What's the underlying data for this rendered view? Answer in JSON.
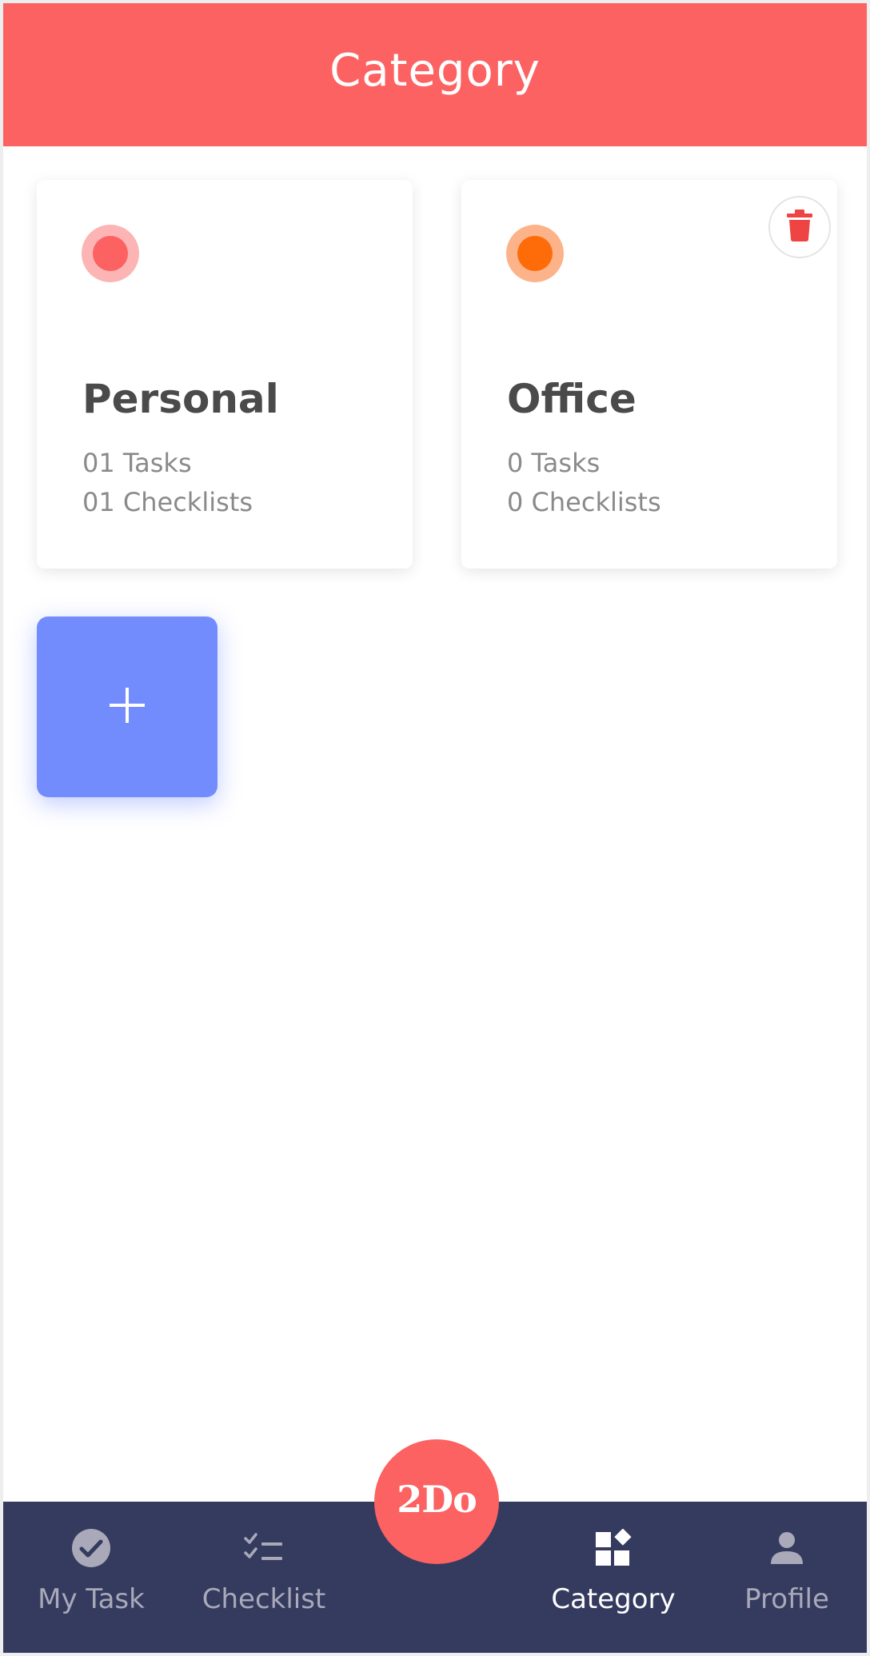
{
  "header": {
    "title": "Category"
  },
  "categories": [
    {
      "name": "Personal",
      "tasks": "01 Tasks",
      "checklists": "01 Checklists",
      "ring_color": "#fcb4b4",
      "dot_color": "#fc6262",
      "deletable": false
    },
    {
      "name": "Office",
      "tasks": "0 Tasks",
      "checklists": "0 Checklists",
      "ring_color": "#fdb38a",
      "dot_color": "#fd6c08",
      "deletable": true,
      "delete_icon": "trash-icon",
      "delete_color": "#ef4444"
    }
  ],
  "add_button": {
    "icon": "plus-icon",
    "color": "#738cfd"
  },
  "logo": {
    "text": "2Do",
    "color": "#fc6262"
  },
  "bottom_nav": {
    "items": [
      {
        "label": "My Task",
        "icon": "check-circle-icon",
        "active": false
      },
      {
        "label": "Checklist",
        "icon": "checklist-icon",
        "active": false
      },
      {
        "label": "Category",
        "icon": "category-icon",
        "active": true
      },
      {
        "label": "Profile",
        "icon": "person-icon",
        "active": false
      }
    ],
    "background": "#353b5e"
  },
  "colors": {
    "accent": "#fc6262",
    "nav_inactive": "#a9a9ba",
    "nav_active": "#ffffff"
  }
}
